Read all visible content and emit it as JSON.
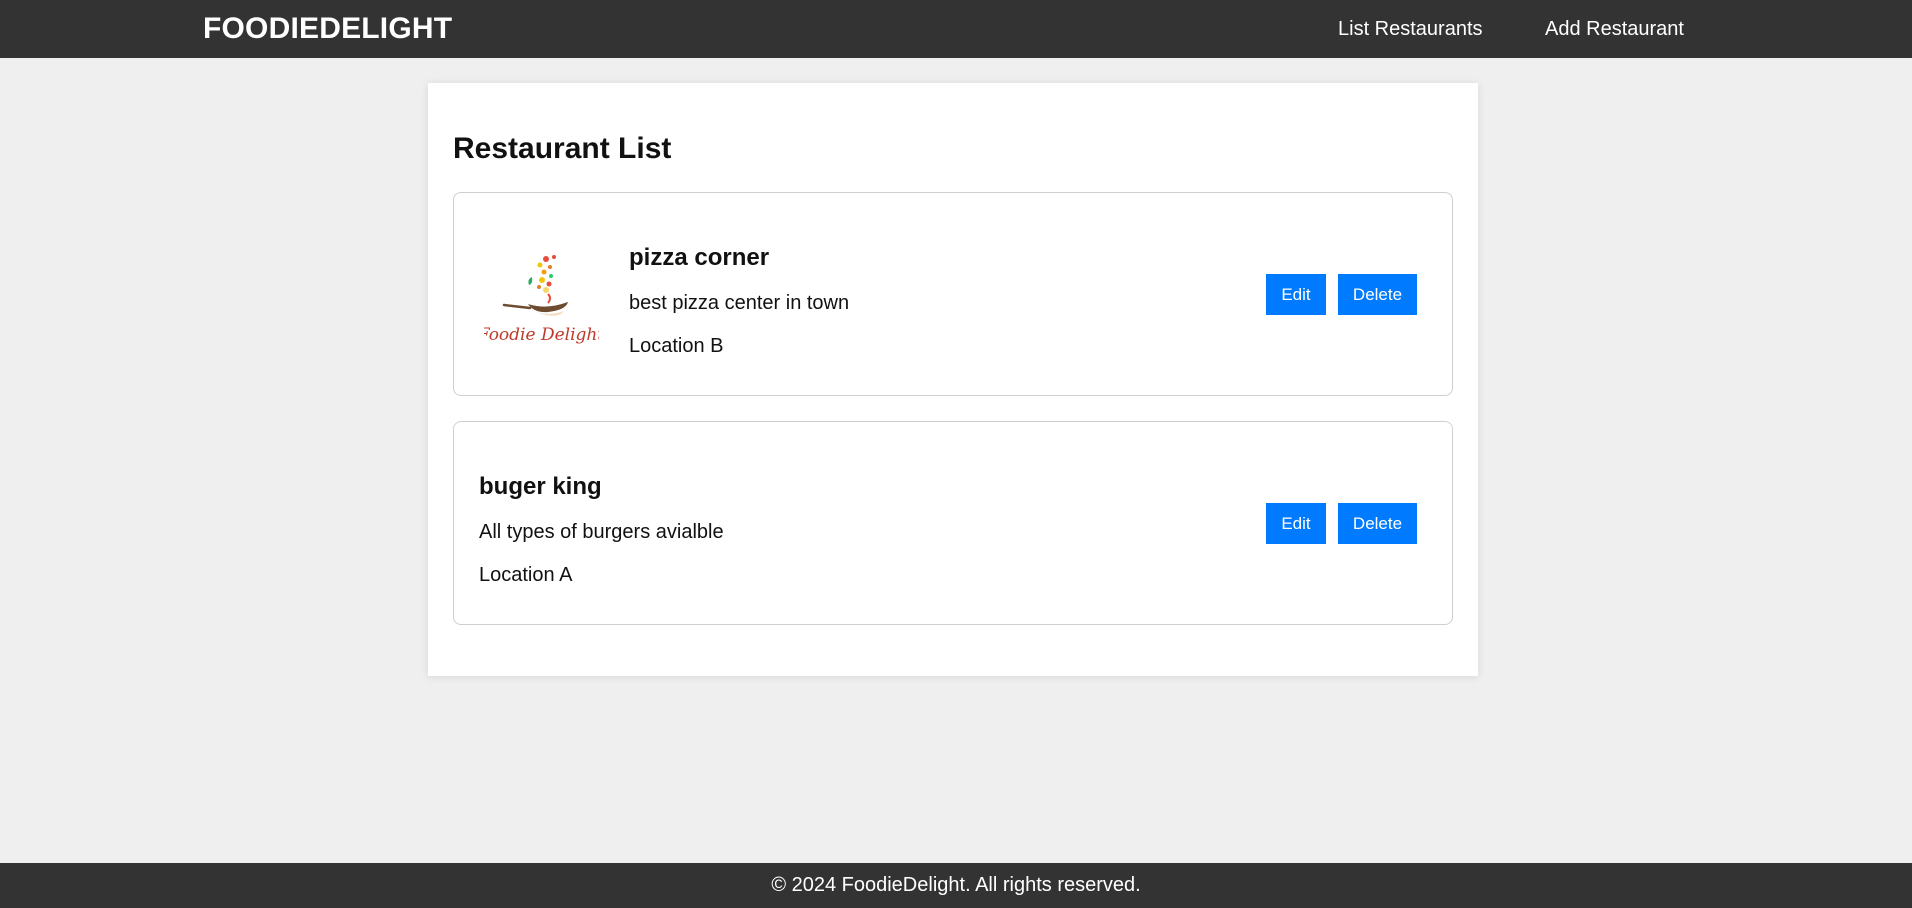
{
  "header": {
    "brand": "FOODIEDELIGHT",
    "nav": {
      "list_restaurants": "List Restaurants",
      "add_restaurant": "Add Restaurant"
    }
  },
  "main": {
    "title": "Restaurant List",
    "restaurants": [
      {
        "name": "pizza corner",
        "description": "best pizza center in town",
        "location": "Location B",
        "has_logo": true,
        "logo_text": "Foodie Delight",
        "edit_label": "Edit",
        "delete_label": "Delete"
      },
      {
        "name": "buger king",
        "description": "All types of burgers avialble",
        "location": "Location A",
        "has_logo": false,
        "edit_label": "Edit",
        "delete_label": "Delete"
      }
    ]
  },
  "footer": {
    "text": "© 2024 FoodieDelight. All rights reserved."
  },
  "colors": {
    "header_bg": "#333333",
    "page_bg": "#efefef",
    "button_bg": "#007bff",
    "logo_text": "#c0392b"
  }
}
